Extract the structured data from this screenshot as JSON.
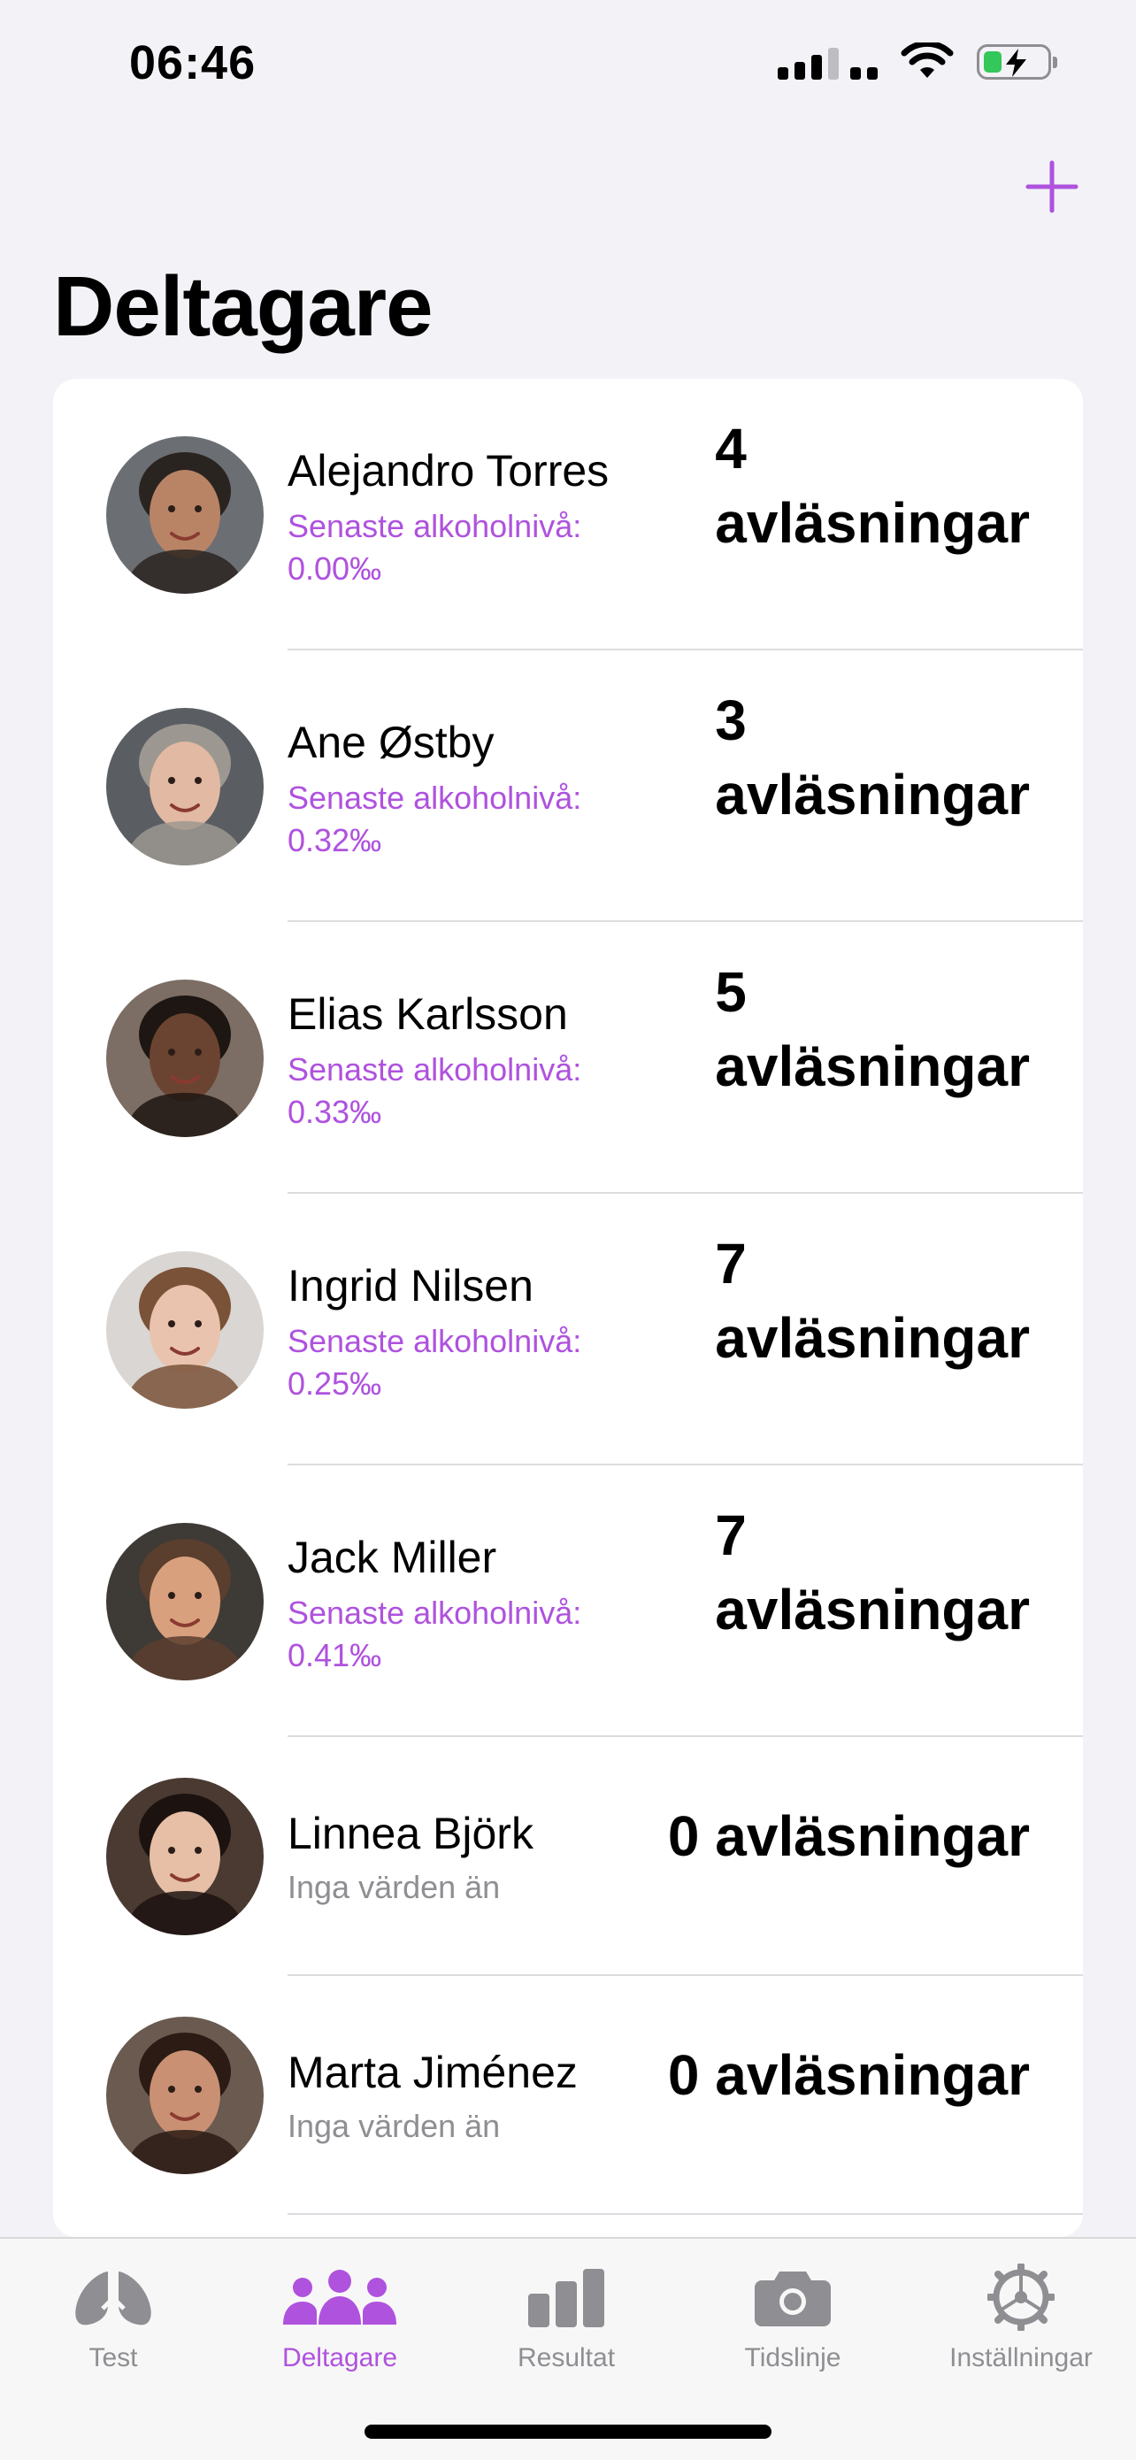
{
  "status_bar": {
    "time": "06:46"
  },
  "nav": {
    "title": "Deltagare",
    "add_icon": "plus-icon",
    "accent": "#AF52DE"
  },
  "participants": [
    {
      "name": "Alejandro Torres",
      "sub_label": "Senaste alkoholnivå:",
      "sub_value": "0.00‰",
      "count": "4",
      "count_suffix": "avläsningar",
      "skin": "#B98466",
      "hair": "#2A2420",
      "bg": "#6B6F74"
    },
    {
      "name": "Ane Østby",
      "sub_label": "Senaste alkoholnivå:",
      "sub_value": "0.32‰",
      "count": "3",
      "count_suffix": "avläsningar",
      "skin": "#E2B9A3",
      "hair": "#9C9891",
      "bg": "#5A5E63"
    },
    {
      "name": "Elias Karlsson",
      "sub_label": "Senaste alkoholnivå:",
      "sub_value": "0.33‰",
      "count": "5",
      "count_suffix": "avläsningar",
      "skin": "#6B4431",
      "hair": "#1E1612",
      "bg": "#7C6E64"
    },
    {
      "name": "Ingrid Nilsen",
      "sub_label": "Senaste alkoholnivå:",
      "sub_value": "0.25‰",
      "count": "7",
      "count_suffix": "avläsningar",
      "skin": "#EAC3AE",
      "hair": "#7A5238",
      "bg": "#D9D6D3"
    },
    {
      "name": "Jack Miller",
      "sub_label": "Senaste alkoholnivå:",
      "sub_value": "0.41‰",
      "count": "7",
      "count_suffix": "avläsningar",
      "skin": "#D9A07E",
      "hair": "#5A3E2E",
      "bg": "#3E3A36"
    },
    {
      "name": "Linnea Björk",
      "sub_gray": "Inga värden än",
      "count_full": "0 avläsningar",
      "skin": "#E6BFA6",
      "hair": "#1C1310",
      "bg": "#4A3A32"
    },
    {
      "name": "Marta Jiménez",
      "sub_gray": "Inga värden än",
      "count_full": "0 avläsningar",
      "skin": "#C99074",
      "hair": "#2B1B14",
      "bg": "#6A5A4F"
    }
  ],
  "tabs": [
    {
      "label": "Test",
      "icon": "lungs-icon",
      "active": false
    },
    {
      "label": "Deltagare",
      "icon": "people-icon",
      "active": true
    },
    {
      "label": "Resultat",
      "icon": "bar-chart-icon",
      "active": false
    },
    {
      "label": "Tidslinje",
      "icon": "camera-icon",
      "active": false
    },
    {
      "label": "Inställningar",
      "icon": "gear-icon",
      "active": false
    }
  ]
}
